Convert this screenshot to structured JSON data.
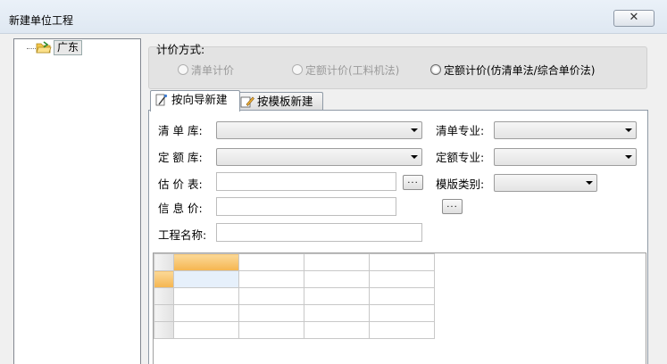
{
  "window": {
    "title": "新建单位工程",
    "close_symbol": "✕"
  },
  "tree": {
    "root_label": "广东"
  },
  "pricing": {
    "title": "计价方式:",
    "options": [
      {
        "label": "清单计价",
        "enabled": false,
        "selected": false
      },
      {
        "label": "定额计价(工料机法)",
        "enabled": false,
        "selected": false
      },
      {
        "label": "定额计价(仿清单法/综合单价法)",
        "enabled": true,
        "selected": false
      }
    ]
  },
  "tabs": [
    {
      "label": "按向导新建",
      "selected": true
    },
    {
      "label": "按模板新建",
      "selected": false
    }
  ],
  "form": {
    "list_lib": {
      "label": "清 单 库:",
      "value": ""
    },
    "list_major": {
      "label": "清单专业:",
      "value": ""
    },
    "quota_lib": {
      "label": "定 额 库:",
      "value": ""
    },
    "quota_major": {
      "label": "定额专业:",
      "value": ""
    },
    "price_table": {
      "label": "估 价 表:",
      "value": ""
    },
    "template_type": {
      "label": "模版类别:",
      "value": ""
    },
    "info_price": {
      "label": "信 息 价:",
      "value": ""
    },
    "project_name": {
      "label": "工程名称:",
      "value": ""
    },
    "browse_label": "..."
  },
  "grid": {
    "columns": 4,
    "rows": 4
  }
}
